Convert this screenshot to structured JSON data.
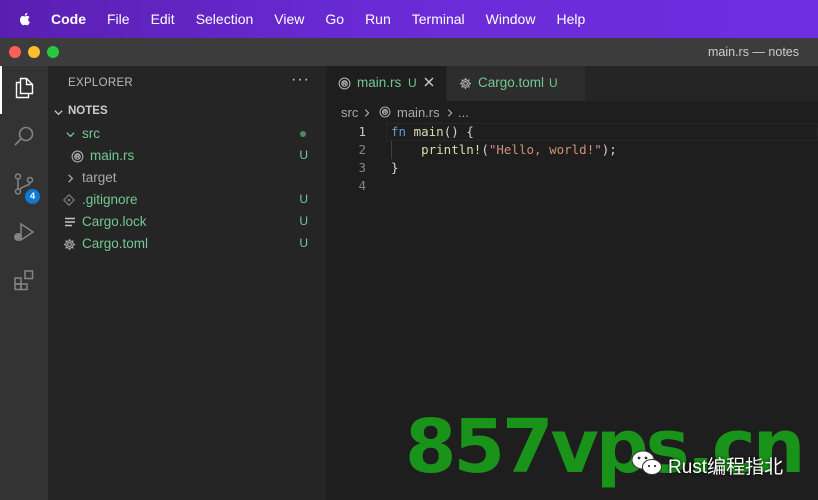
{
  "menubar": {
    "app": "Code",
    "items": [
      "File",
      "Edit",
      "Selection",
      "View",
      "Go",
      "Run",
      "Terminal",
      "Window",
      "Help"
    ]
  },
  "window": {
    "title": "main.rs — notes"
  },
  "activity_bar": {
    "items": [
      "explorer-icon",
      "search-icon",
      "source-control-icon",
      "run-debug-icon",
      "extensions-icon"
    ],
    "source_control_badge": "4"
  },
  "sidebar": {
    "title": "EXPLORER",
    "more": "···",
    "section": "NOTES",
    "tree": [
      {
        "name": "src",
        "kind": "folder-open",
        "status": "",
        "modified_dot": true
      },
      {
        "name": "main.rs",
        "kind": "rust-file",
        "status": "U"
      },
      {
        "name": "target",
        "kind": "folder-closed",
        "status": ""
      },
      {
        "name": ".gitignore",
        "kind": "git-file",
        "status": "U"
      },
      {
        "name": "Cargo.lock",
        "kind": "lock-file",
        "status": "U"
      },
      {
        "name": "Cargo.toml",
        "kind": "gear-file",
        "status": "U"
      }
    ]
  },
  "editor": {
    "tabs": [
      {
        "label": "main.rs",
        "status": "U",
        "active": true
      },
      {
        "label": "Cargo.toml",
        "status": "U",
        "active": false
      }
    ],
    "breadcrumb": {
      "folder": "src",
      "file": "main.rs",
      "rest": "..."
    },
    "lines": [
      {
        "number": "1",
        "kw": "fn",
        "name": "main",
        "rest": "() {"
      },
      {
        "number": "2",
        "macro": "println!",
        "open": "(",
        "str": "\"Hello, world!\"",
        "close": ");"
      },
      {
        "number": "3",
        "text": "}"
      },
      {
        "number": "4",
        "text": ""
      }
    ]
  },
  "watermark": {
    "site": "857vps.cn",
    "account": "Rust编程指北"
  },
  "colors": {
    "accent": "#6a2bd6",
    "untracked": "#73c991",
    "badge": "#0e7ad3"
  }
}
